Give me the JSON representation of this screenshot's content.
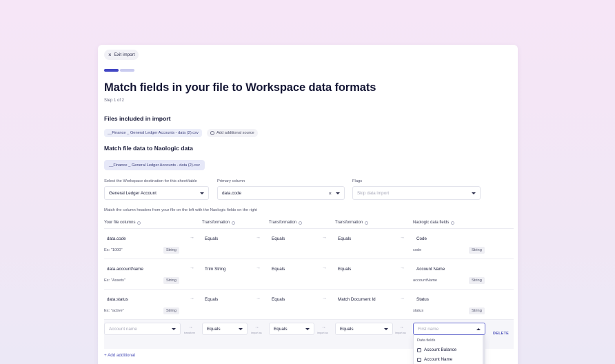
{
  "header": {
    "exit_label": "Exit import",
    "title": "Match fields in your file to Workspace data formats",
    "step": "Step 1 of 2"
  },
  "files": {
    "heading": "Files included in import",
    "file_name": "__Finance _ General Ledger Accounts - data (2).csv",
    "add_source": "Add additional source"
  },
  "match": {
    "heading": "Match file data to Naologic data",
    "file_tab": "__Finance _ General Ledger Accounts - data (2).csv",
    "destination": {
      "label": "Select the Workspace destination for this sheet/table",
      "value": "General Ledger Account"
    },
    "primary": {
      "label": "Primary column",
      "value": "data.code"
    },
    "flags": {
      "label": "Flags",
      "placeholder": "Skip data import"
    },
    "instructions": "Match the column headers from your file on the left with the Naologic fields on the right"
  },
  "columns": {
    "your_file": "Your file columns",
    "transformation": "Transformation",
    "naologic": "Naologic data fields"
  },
  "rows": [
    {
      "column": "data.code",
      "example": "Ex: \"1000\"",
      "type": "String",
      "t1": "Equals",
      "t2": "Equals",
      "t3": "Equals",
      "field": "Code",
      "field_key": "code",
      "field_type": "String"
    },
    {
      "column": "data.accountName",
      "example": "Ex: \"Assets\"",
      "type": "String",
      "t1": "Trim String",
      "t2": "Equals",
      "t3": "Equals",
      "field": "Account Name",
      "field_key": "accountName",
      "field_type": "String"
    },
    {
      "column": "data.status",
      "example": "Ex: \"active\"",
      "type": "String",
      "t1": "Equals",
      "t2": "Equals",
      "t3": "Match Document Id",
      "field": "Status",
      "field_key": "status",
      "field_type": "String"
    }
  ],
  "new_row": {
    "column_placeholder": "Account name",
    "t1": "Equals",
    "t2": "Equals",
    "t3": "Equals",
    "caption_1": "transform",
    "caption_2": "import as",
    "caption_3": "import as",
    "caption_4": "import as",
    "field_placeholder": "First name",
    "delete_label": "DELETE"
  },
  "dropdown": {
    "section": "Data fields",
    "items": [
      "Account Balance",
      "Account Name"
    ]
  },
  "add_additional": "+ Add additional",
  "colors": {
    "accent": "#4a4fb8",
    "step_active": "#4347c4",
    "step_inactive": "#c9cbef"
  }
}
